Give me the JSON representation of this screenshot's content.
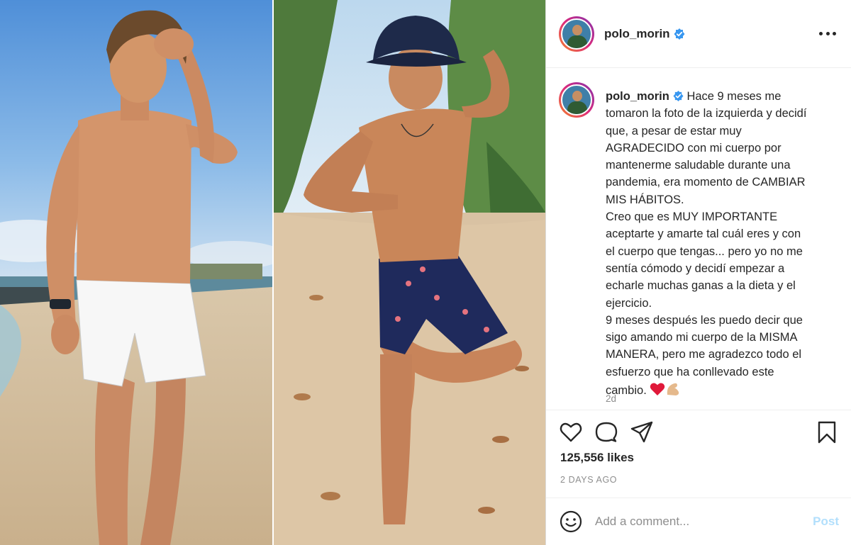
{
  "post": {
    "username": "polo_morin",
    "verified": true,
    "caption_lines": [
      "Hace 9 meses me",
      "tomaron la foto de la izquierda y decidí",
      "que, a pesar de estar muy",
      "AGRADECIDO con mi cuerpo por",
      "mantenerme saludable durante una",
      "pandemia, era momento de CAMBIAR",
      "MIS HÁBITOS.",
      "Creo que es MUY IMPORTANTE",
      "aceptarte y amarte tal cuál eres y con",
      "el cuerpo que tengas... pero yo no me",
      "sentía cómodo y decidí empezar a",
      "echarle muchas ganas a la dieta y el",
      "ejercicio.",
      "9 meses después les puedo decir que",
      "sigo amando mi cuerpo de la MISMA",
      "MANERA, pero me agradezco todo el",
      "esfuerzo que ha conllevado este",
      "cambio."
    ],
    "caption_emojis": [
      "heart-emoji",
      "flexed-biceps-emoji"
    ],
    "relative_time": "2d",
    "likes_label": "125,556 likes",
    "date_label": "2 DAYS AGO"
  },
  "comment": {
    "placeholder": "Add a comment...",
    "post_label": "Post"
  },
  "icons": {
    "header": [
      "verified-badge-icon",
      "more-options-icon"
    ],
    "actions": [
      "heart-icon",
      "comment-icon",
      "share-icon",
      "bookmark-icon"
    ],
    "comment": [
      "emoji-icon"
    ]
  },
  "colors": {
    "verified": "#3897f0",
    "post_button": "#b2dffc",
    "secondary_text": "#8e8e8e",
    "primary_text": "#262626",
    "heart_emoji": "#e0193a"
  }
}
